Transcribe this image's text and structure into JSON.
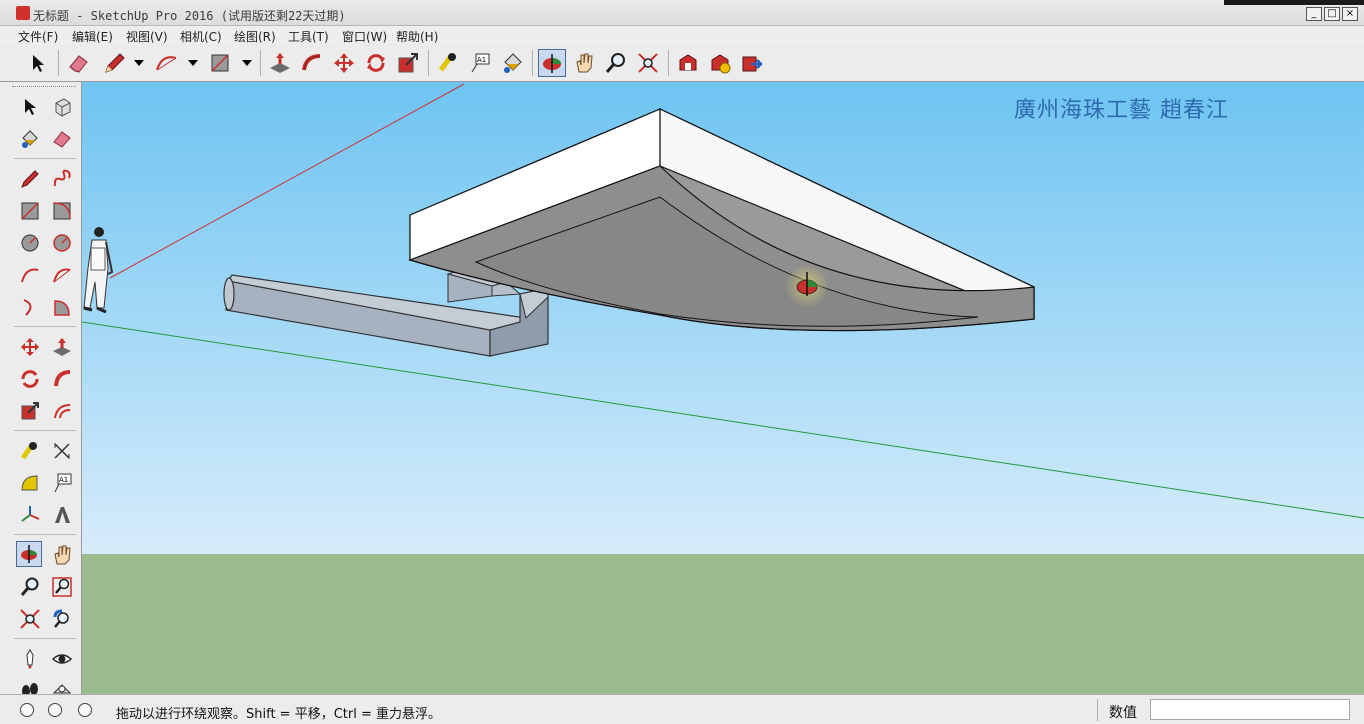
{
  "window": {
    "title": "无标题 - SketchUp Pro 2016 (试用版还剩22天过期)",
    "min_label": "_",
    "max_label": "□",
    "close_label": "×"
  },
  "menubar": {
    "items": [
      "文件(F)",
      "编辑(E)",
      "视图(V)",
      "相机(C)",
      "绘图(R)",
      "工具(T)",
      "窗口(W)",
      "帮助(H)"
    ]
  },
  "toolbar": {
    "icons": [
      "select-icon",
      "eraser-icon",
      "pencil-icon",
      "arc-icon",
      "rectangle-icon",
      "push-pull-icon",
      "follow-me-icon",
      "move-icon",
      "rotate-icon",
      "scale-icon",
      "tape-measure-icon",
      "text-icon",
      "paint-bucket-icon",
      "orbit-icon",
      "pan-icon",
      "zoom-icon",
      "zoom-extents-icon",
      "warehouse-icon",
      "extension-icon",
      "share-model-icon"
    ]
  },
  "viewport": {
    "watermark": "廣州海珠工藝  趙春江",
    "sky_top": "#6ec4f2",
    "sky_bottom": "#d6ecfa",
    "ground": "#9bbd8e"
  },
  "statusbar": {
    "message": "拖动以进行环绕观察。Shift = 平移，Ctrl = 重力悬浮。",
    "vcb_label": "数值",
    "vcb_value": ""
  }
}
